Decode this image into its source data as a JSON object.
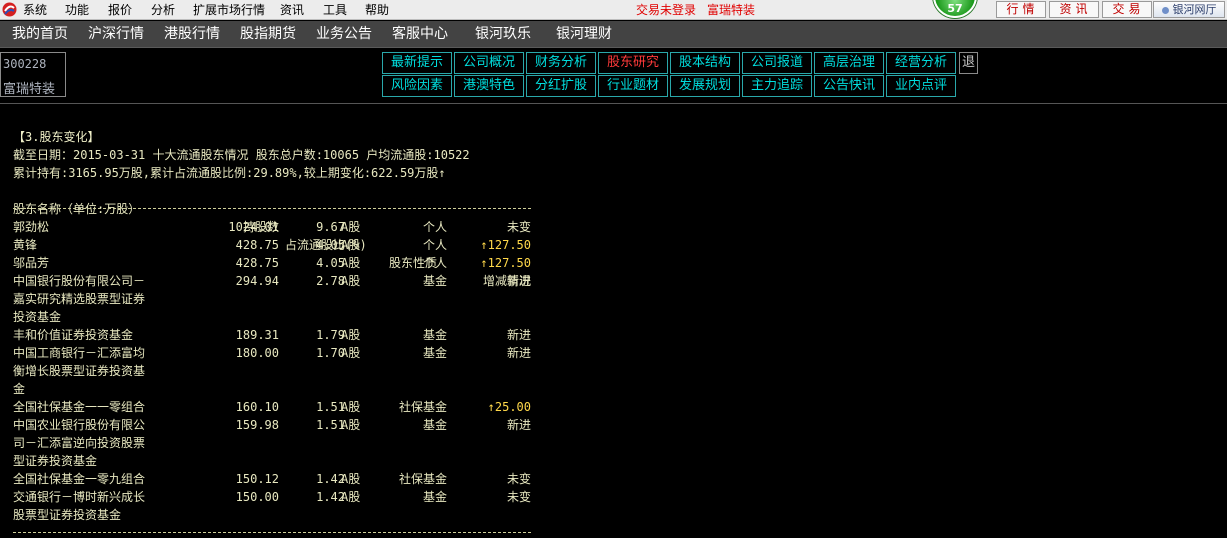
{
  "menu": {
    "items": [
      "系统",
      "功能",
      "报价",
      "分析",
      "扩展市场行情",
      "资讯",
      "工具",
      "帮助"
    ],
    "login_status": "交易未登录",
    "special_label": "富瑞特装",
    "badge_value": "57",
    "quick_buttons": [
      "行情",
      "资讯",
      "交易"
    ],
    "hall_button": "银河网厅"
  },
  "nav": {
    "items": [
      "我的首页",
      "沪深行情",
      "港股行情",
      "股指期货",
      "业务公告",
      "客服中心",
      "银河玖乐",
      "银河理财"
    ]
  },
  "stock": {
    "code": "300228",
    "name": "富瑞特装"
  },
  "tabs": {
    "row1": [
      "最新提示",
      "公司概况",
      "财务分析",
      "股东研究",
      "股本结构",
      "公司报道",
      "高层治理",
      "经营分析"
    ],
    "row2": [
      "风险因素",
      "港澳特色",
      "分红扩股",
      "行业题材",
      "发展规划",
      "主力追踪",
      "公告快讯",
      "业内点评"
    ],
    "active": "股东研究",
    "exit_label": "退"
  },
  "report": {
    "section_title": "【3.股东变化】",
    "summary_line1": "截至日期：2015-03-31 十大流通股东情况 股东总户数:10065 户均流通股:10522",
    "summary_line2": "累计持有:3165.95万股,累计占流通股比例:29.89%,较上期变化:622.59万股↑",
    "headers": {
      "name": "股东名称（单位:万股）",
      "hold": "持股数",
      "ratio": "占流通股比(%)",
      "nature": "股东性质",
      "change": "增减情况"
    },
    "rows": [
      {
        "name": [
          "郭劲松"
        ],
        "hold": "1024.01",
        "ratio": "9.67",
        "type": "A股",
        "nature": "个人",
        "change": "未变"
      },
      {
        "name": [
          "黄锋"
        ],
        "hold": "428.75",
        "ratio": "4.05",
        "type": "A股",
        "nature": "个人",
        "change": "↑127.50"
      },
      {
        "name": [
          "邬品芳"
        ],
        "hold": "428.75",
        "ratio": "4.05",
        "type": "A股",
        "nature": "个人",
        "change": "↑127.50"
      },
      {
        "name": [
          "中国银行股份有限公司－",
          "嘉实研究精选股票型证券",
          "投资基金"
        ],
        "hold": "294.94",
        "ratio": "2.78",
        "type": "A股",
        "nature": "基金",
        "change": "新进"
      },
      {
        "name": [
          "丰和价值证券投资基金"
        ],
        "hold": "189.31",
        "ratio": "1.79",
        "type": "A股",
        "nature": "基金",
        "change": "新进"
      },
      {
        "name": [
          "中国工商银行－汇添富均",
          "衡增长股票型证券投资基",
          "金"
        ],
        "hold": "180.00",
        "ratio": "1.70",
        "type": "A股",
        "nature": "基金",
        "change": "新进"
      },
      {
        "name": [
          "全国社保基金一一零组合"
        ],
        "hold": "160.10",
        "ratio": "1.51",
        "type": "A股",
        "nature": "社保基金",
        "change": "↑25.00"
      },
      {
        "name": [
          "中国农业银行股份有限公",
          "司－汇添富逆向投资股票",
          "型证券投资基金"
        ],
        "hold": "159.98",
        "ratio": "1.51",
        "type": "A股",
        "nature": "基金",
        "change": "新进"
      },
      {
        "name": [
          "全国社保基金一零九组合"
        ],
        "hold": "150.12",
        "ratio": "1.42",
        "type": "A股",
        "nature": "社保基金",
        "change": "未变"
      },
      {
        "name": [
          "交通银行－博时新兴成长",
          "股票型证券投资基金"
        ],
        "hold": "150.00",
        "ratio": "1.42",
        "type": "A股",
        "nature": "基金",
        "change": "未变"
      }
    ]
  }
}
